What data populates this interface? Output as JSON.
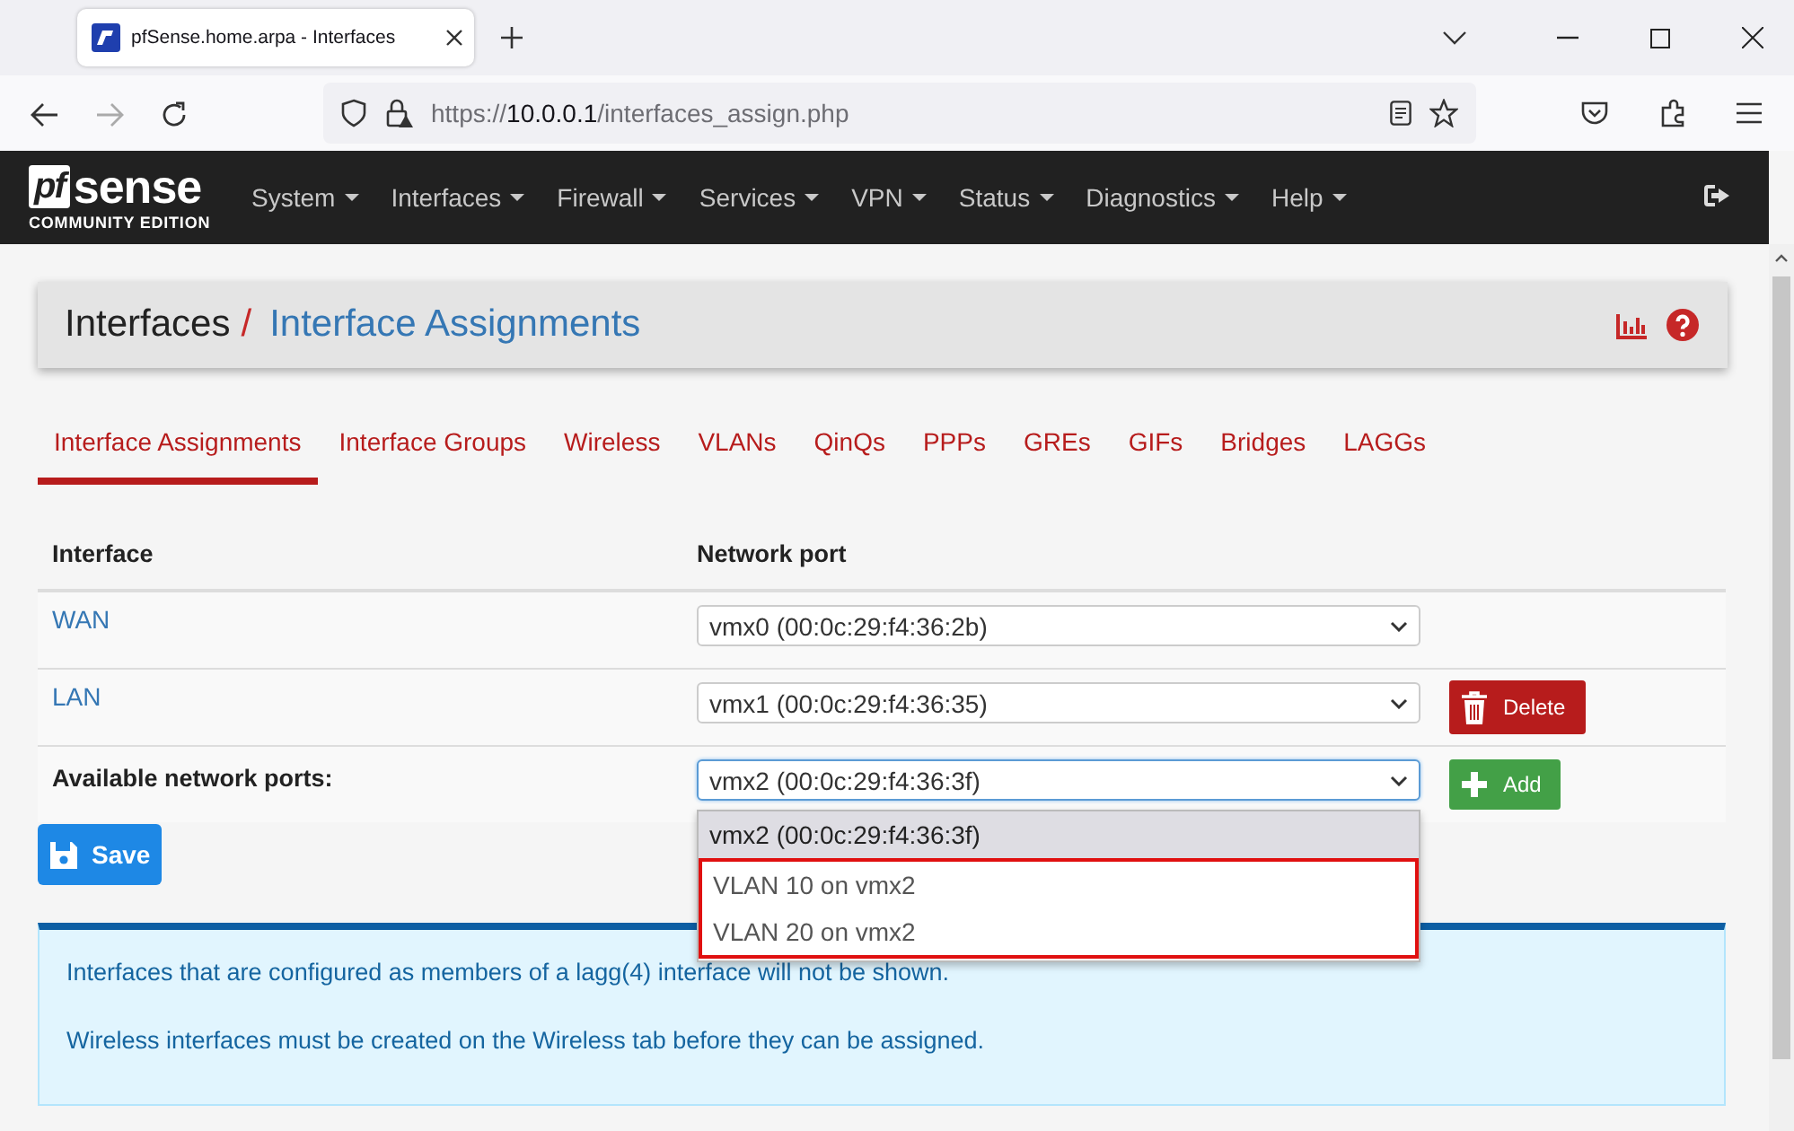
{
  "browser": {
    "tab_title": "pfSense.home.arpa - Interfaces",
    "url_scheme": "https://",
    "url_host": "10.0.0.1",
    "url_path": "/interfaces_assign.php"
  },
  "navbar": {
    "logo_mark": "pf",
    "logo_word": "sense",
    "logo_edition": "COMMUNITY EDITION",
    "menu": [
      "System",
      "Interfaces",
      "Firewall",
      "Services",
      "VPN",
      "Status",
      "Diagnostics",
      "Help"
    ]
  },
  "breadcrumb": {
    "parent": "Interfaces",
    "separator": "/",
    "current": "Interface Assignments"
  },
  "tabs": [
    {
      "label": "Interface Assignments",
      "selected": true
    },
    {
      "label": "Interface Groups",
      "selected": false
    },
    {
      "label": "Wireless",
      "selected": false
    },
    {
      "label": "VLANs",
      "selected": false
    },
    {
      "label": "QinQs",
      "selected": false
    },
    {
      "label": "PPPs",
      "selected": false
    },
    {
      "label": "GREs",
      "selected": false
    },
    {
      "label": "GIFs",
      "selected": false
    },
    {
      "label": "Bridges",
      "selected": false
    },
    {
      "label": "LAGGs",
      "selected": false
    }
  ],
  "table": {
    "columns": [
      "Interface",
      "Network port"
    ],
    "rows": [
      {
        "kind": "link",
        "interface": "WAN",
        "port": "vmx0 (00:0c:29:f4:36:2b)",
        "focused": false
      },
      {
        "kind": "link",
        "interface": "LAN",
        "port": "vmx1 (00:0c:29:f4:36:35)",
        "focused": false,
        "action": {
          "kind": "delete",
          "label": "Delete"
        }
      },
      {
        "kind": "label",
        "interface": "Available network ports:",
        "port": "vmx2 (00:0c:29:f4:36:3f)",
        "focused": true,
        "action": {
          "kind": "add",
          "label": "Add"
        },
        "dropdown": [
          {
            "label": "vmx2 (00:0c:29:f4:36:3f)",
            "selected": true,
            "highlighted": false
          },
          {
            "label": "VLAN 10 on vmx2",
            "selected": false,
            "highlighted": true
          },
          {
            "label": "VLAN 20 on vmx2",
            "selected": false,
            "highlighted": true
          }
        ]
      }
    ]
  },
  "save_button": "Save",
  "info": [
    "Interfaces that are configured as members of a lagg(4) interface will not be shown.",
    "Wireless interfaces must be created on the Wireless tab before they can be assigned."
  ]
}
